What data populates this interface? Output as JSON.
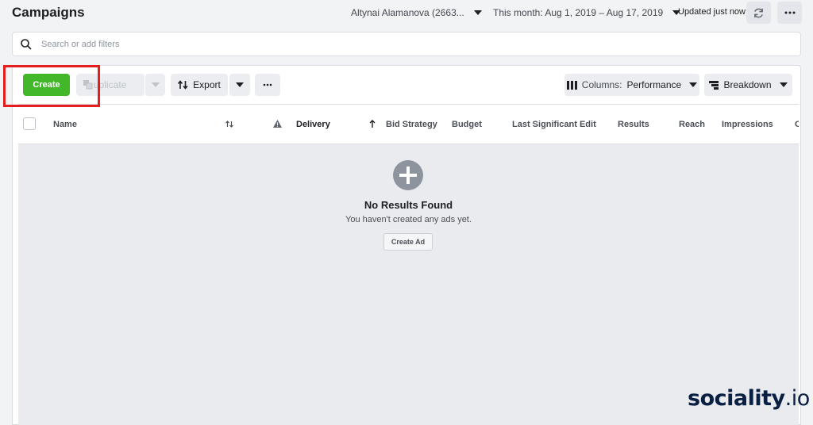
{
  "header": {
    "title": "Campaigns",
    "account": "Altynai Alamanova (2663...",
    "date_range": "This month: Aug 1, 2019 – Aug 17, 2019",
    "updated": "Updated just now"
  },
  "search": {
    "placeholder": "Search or add filters"
  },
  "toolbar": {
    "create_label": "Create",
    "duplicate_label": "uplicate",
    "export_label": "Export",
    "columns_prefix": "Columns:",
    "columns_value": "Performance",
    "breakdown_label": "Breakdown"
  },
  "table": {
    "columns": [
      "Name",
      "Delivery",
      "Bid Strategy",
      "Budget",
      "Last Significant Edit",
      "Results",
      "Reach",
      "Impressions",
      "C"
    ]
  },
  "empty_state": {
    "title": "No Results Found",
    "subtitle": "You haven't created any ads yet.",
    "button": "Create Ad"
  },
  "watermark": {
    "brand": "sociality",
    "suffix": ".io"
  },
  "colors": {
    "create_green": "#42b72a",
    "highlight_red": "#e41e1e",
    "brand_navy": "#0a1f44"
  },
  "icons": {
    "search": "search-icon",
    "refresh": "refresh-icon",
    "more": "more-icon",
    "duplicate": "duplicate-icon",
    "export": "export-icon",
    "columns": "columns-icon",
    "breakdown": "breakdown-icon",
    "sort": "sort-icon",
    "warning": "warning-icon",
    "sort_up": "arrow-up-icon",
    "plus": "plus-circle-icon"
  }
}
